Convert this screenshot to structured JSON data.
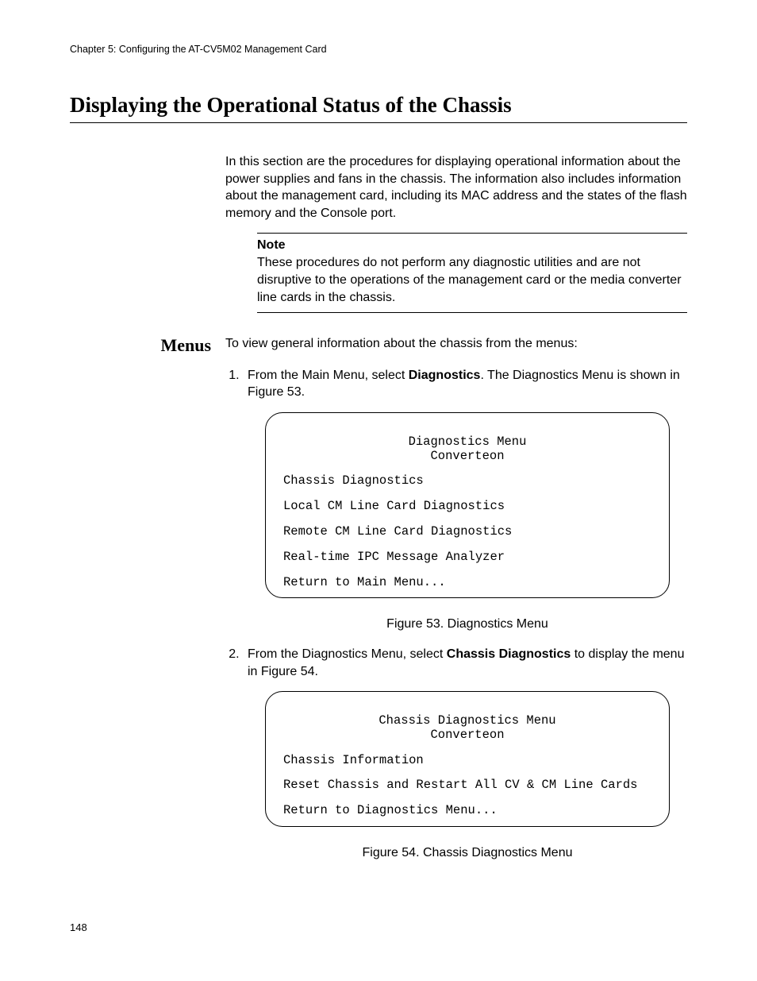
{
  "header": {
    "running": "Chapter 5: Configuring the AT-CV5M02 Management Card"
  },
  "title": "Displaying the Operational Status of the Chassis",
  "intro": "In this section are the procedures for displaying operational information about the power supplies and fans in the chassis. The information also includes information about the management card, including its MAC address and the states of the flash memory and the Console port.",
  "note": {
    "label": "Note",
    "text": "These procedures do not perform any diagnostic utilities and are not disruptive to the operations of the management card or the media converter line cards in the chassis."
  },
  "sidehead": "Menus",
  "menus_intro": "To view general information about the chassis from the menus:",
  "step1_pre": "From the Main Menu, select ",
  "step1_bold": "Diagnostics",
  "step1_post": ". The Diagnostics Menu is shown in Figure 53.",
  "fig53": {
    "title": "Diagnostics Menu",
    "subtitle": "Converteon",
    "items": [
      "Chassis Diagnostics",
      "Local CM Line Card Diagnostics",
      "Remote CM Line Card Diagnostics",
      "Real-time IPC Message Analyzer",
      "Return to Main Menu..."
    ],
    "caption": "Figure 53. Diagnostics Menu"
  },
  "step2_pre": "From the Diagnostics Menu, select ",
  "step2_bold": "Chassis Diagnostics",
  "step2_post": " to display the menu in Figure 54.",
  "fig54": {
    "title": "Chassis Diagnostics Menu",
    "subtitle": "Converteon",
    "items": [
      "Chassis Information",
      "Reset Chassis and Restart All CV & CM Line Cards",
      "Return to Diagnostics Menu..."
    ],
    "caption": "Figure 54. Chassis Diagnostics Menu"
  },
  "page_number": "148"
}
